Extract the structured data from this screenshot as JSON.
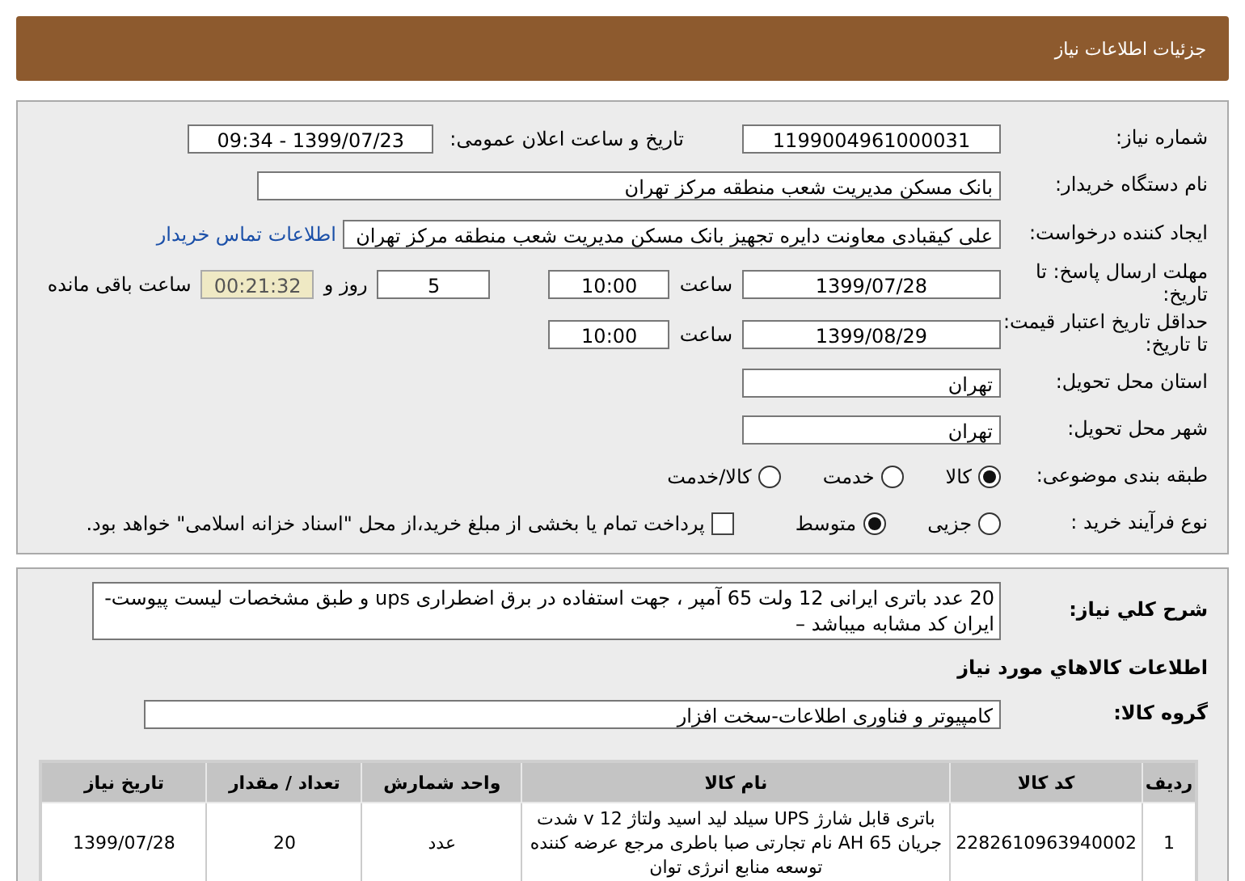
{
  "header": {
    "title": "جزئیات اطلاعات نیاز"
  },
  "need_number": {
    "label": "شماره نیاز:",
    "value": "1199004961000031"
  },
  "announce": {
    "label": "تاریخ و ساعت اعلان عمومی:",
    "value": "1399/07/23 - 09:34"
  },
  "buyer": {
    "label": "نام دستگاه خریدار:",
    "value": "بانک مسکن مدیریت شعب منطقه مرکز تهران"
  },
  "requester": {
    "label": "ایجاد کننده درخواست:",
    "value": "علی کیقبادی معاونت دایره تجهیز  بانک مسکن مدیریت شعب منطقه مرکز تهران",
    "contact_link": "اطلاعات تماس خریدار"
  },
  "deadline": {
    "label": "مهلت ارسال پاسخ: تا تاریخ:",
    "date": "1399/07/28",
    "time_label": "ساعت",
    "time": "10:00",
    "days": "5",
    "days_label": "روز و",
    "remaining": "00:21:32",
    "remaining_label": "ساعت باقی مانده"
  },
  "validity": {
    "label": "حداقل تاریخ اعتبار قیمت: تا تاریخ:",
    "date": "1399/08/29",
    "time_label": "ساعت",
    "time": "10:00"
  },
  "province": {
    "label": "استان محل تحویل:",
    "value": "تهران"
  },
  "city": {
    "label": "شهر محل تحویل:",
    "value": "تهران"
  },
  "category": {
    "label": "طبقه بندی موضوعی:",
    "options": [
      {
        "label": "کالا",
        "selected": true
      },
      {
        "label": "خدمت",
        "selected": false
      },
      {
        "label": "کالا/خدمت",
        "selected": false
      }
    ]
  },
  "process": {
    "label": "نوع فرآیند خرید :",
    "options": [
      {
        "label": "جزیی",
        "selected": false
      },
      {
        "label": "متوسط",
        "selected": true
      }
    ],
    "payment": {
      "checked": false,
      "text": "پرداخت تمام یا بخشی از مبلغ خرید،از محل \"اسناد خزانه اسلامی\" خواهد بود."
    }
  },
  "description": {
    "label": "شرح کلي نیاز:",
    "value": "20 عدد باتری ایرانی  12 ولت 65 آمپر ، جهت استفاده در برق اضطراری ups و طبق مشخصات لیست پیوست- ایران کد مشابه میباشد –"
  },
  "goods_title": "اطلاعات کالاهاي مورد نیاز",
  "goods_group": {
    "label": "گروه کالا:",
    "value": "کامپیوتر و فناوری اطلاعات-سخت افزار"
  },
  "table": {
    "columns": [
      "ردیف",
      "کد کالا",
      "نام کالا",
      "واحد شمارش",
      "تعداد / مقدار",
      "تاریخ نیاز"
    ],
    "rows": [
      [
        "1",
        "2282610963940002",
        "باتری قابل شارژ UPS سیلد لید اسید ولتاژ 12 v شدت جریان 65 AH نام تجارتی صبا باطری مرجع عرضه کننده توسعه منابع انرژی توان",
        "عدد",
        "20",
        "1399/07/28"
      ]
    ]
  }
}
